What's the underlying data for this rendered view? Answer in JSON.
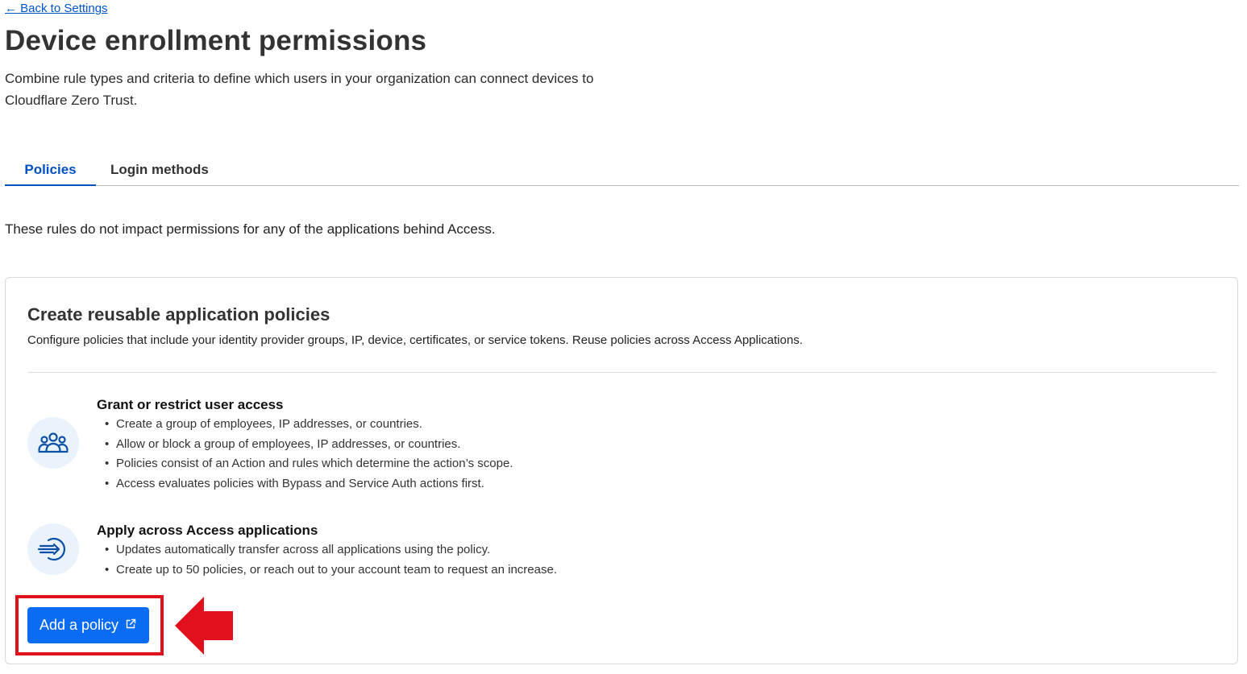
{
  "nav": {
    "back_link": "← Back to Settings"
  },
  "page": {
    "title": "Device enrollment permissions",
    "description": "Combine rule types and criteria to define which users in your organization can connect devices to Cloudflare Zero Trust."
  },
  "tabs": [
    {
      "label": "Policies",
      "active": true
    },
    {
      "label": "Login methods",
      "active": false
    }
  ],
  "notice": "These rules do not impact permissions for any of the applications behind Access.",
  "card": {
    "title": "Create reusable application policies",
    "description": "Configure policies that include your identity provider groups, IP, device, certificates, or service tokens. Reuse policies across Access Applications.",
    "features": [
      {
        "icon": "users-group-icon",
        "title": "Grant or restrict user access",
        "items": [
          "Create a group of employees, IP addresses, or countries.",
          "Allow or block a group of employees, IP addresses, or countries.",
          "Policies consist of an Action and rules which determine the action’s scope.",
          "Access evaluates policies with Bypass and Service Auth actions first."
        ]
      },
      {
        "icon": "apply-arrow-icon",
        "title": "Apply across Access applications",
        "items": [
          "Updates automatically transfer across all applications using the policy.",
          "Create up to 50 policies, or reach out to your account team to request an increase."
        ]
      }
    ],
    "button_label": "Add a policy",
    "button_icon": "external-link-icon"
  },
  "annotation": {
    "highlight_color": "#e0111c",
    "arrow": "red-arrow-left"
  },
  "colors": {
    "accent": "#0051c3",
    "button": "#0a6cf3",
    "icon_bg": "#eaf3fb"
  }
}
